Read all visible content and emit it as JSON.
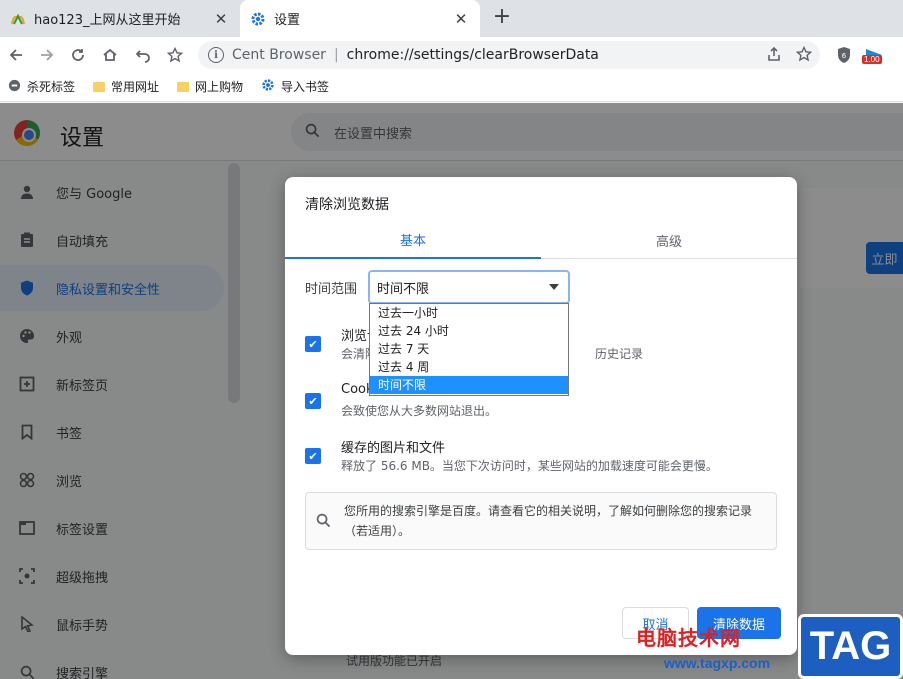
{
  "tabs": [
    {
      "title": "hao123_上网从这里开始"
    },
    {
      "title": "设置"
    }
  ],
  "toolbar": {
    "brand": "Cent Browser",
    "separator": "|",
    "url": "chrome://settings/clearBrowserData",
    "extension_badge": "1.00"
  },
  "bookmarks": [
    {
      "label": "杀死标签"
    },
    {
      "label": "常用网址"
    },
    {
      "label": "网上购物"
    },
    {
      "label": "导入书签"
    }
  ],
  "settings": {
    "title": "设置",
    "search_placeholder": "在设置中搜索",
    "sidebar": [
      {
        "label": "您与 Google"
      },
      {
        "label": "自动填充"
      },
      {
        "label": "隐私设置和安全性"
      },
      {
        "label": "外观"
      },
      {
        "label": "新标签页"
      },
      {
        "label": "书签"
      },
      {
        "label": "浏览"
      },
      {
        "label": "标签设置"
      },
      {
        "label": "超级拖拽"
      },
      {
        "label": "鼠标手势"
      },
      {
        "label": "搜索引擎"
      }
    ],
    "launch_label": "立即",
    "bottom_text": "试用版功能已开启"
  },
  "dialog": {
    "title": "清除浏览数据",
    "tab_basic": "基本",
    "tab_advanced": "高级",
    "time_range_label": "时间范围",
    "time_range_value": "时间不限",
    "time_range_options": [
      "过去一小时",
      "过去 24 小时",
      "过去 7 天",
      "过去 4 周",
      "时间不限"
    ],
    "options": [
      {
        "title": "浏览记",
        "desc": "会清除",
        "desc_tail": "历史记录",
        "checked": true
      },
      {
        "title": "Cook",
        "desc": "会致使您从大多数网站退出。",
        "checked": true
      },
      {
        "title": "缓存的图片和文件",
        "desc": "释放了 56.6 MB。当您下次访问时，某些网站的加载速度可能会更慢。",
        "checked": true
      }
    ],
    "notice": "您所用的搜索引擎是百度。请查看它的相关说明，了解如何删除您的搜索记录（若适用）。",
    "cancel": "取消",
    "clear": "清除数据"
  },
  "watermark": {
    "line1": "电脑技术网",
    "line2": "www.tagxp.com",
    "tag": "TAG"
  },
  "colors": {
    "accent": "#1a73e8",
    "dropdown_selected": "#1e90ff"
  }
}
